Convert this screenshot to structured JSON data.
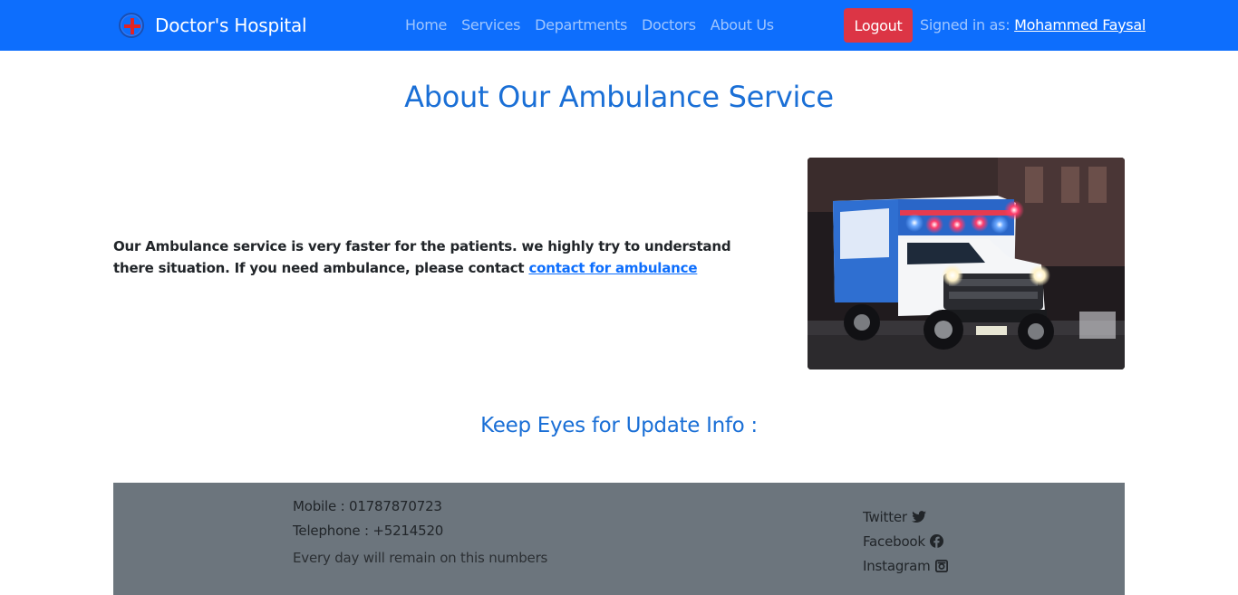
{
  "navbar": {
    "brand": "Doctor's Hospital",
    "links": [
      "Home",
      "Services",
      "Departments",
      "Doctors",
      "About Us"
    ],
    "logout_label": "Logout",
    "signed_in_label": "Signed in as:",
    "user_name": "Mohammed Faysal"
  },
  "main": {
    "title": "About Our Ambulance Service",
    "intro_text": "Our Ambulance service is very faster for the patients. we highly try to understand there situation. If you need ambulance, please contact",
    "intro_link": "contact for ambulance",
    "update_title": "Keep Eyes for Update Info :"
  },
  "footer": {
    "mobile": "Mobile : 01787870723",
    "telephone": "Telephone : +5214520",
    "note": "Every day will remain on this numbers",
    "social": [
      {
        "label": "Twitter",
        "icon": "twitter-icon"
      },
      {
        "label": "Facebook",
        "icon": "facebook-icon"
      },
      {
        "label": "Instagram",
        "icon": "instagram-icon"
      }
    ]
  },
  "colors": {
    "navbar": "#0d6efd",
    "logout": "#dc3545",
    "heading": "#1a6fd6",
    "footer": "#6c757d"
  }
}
